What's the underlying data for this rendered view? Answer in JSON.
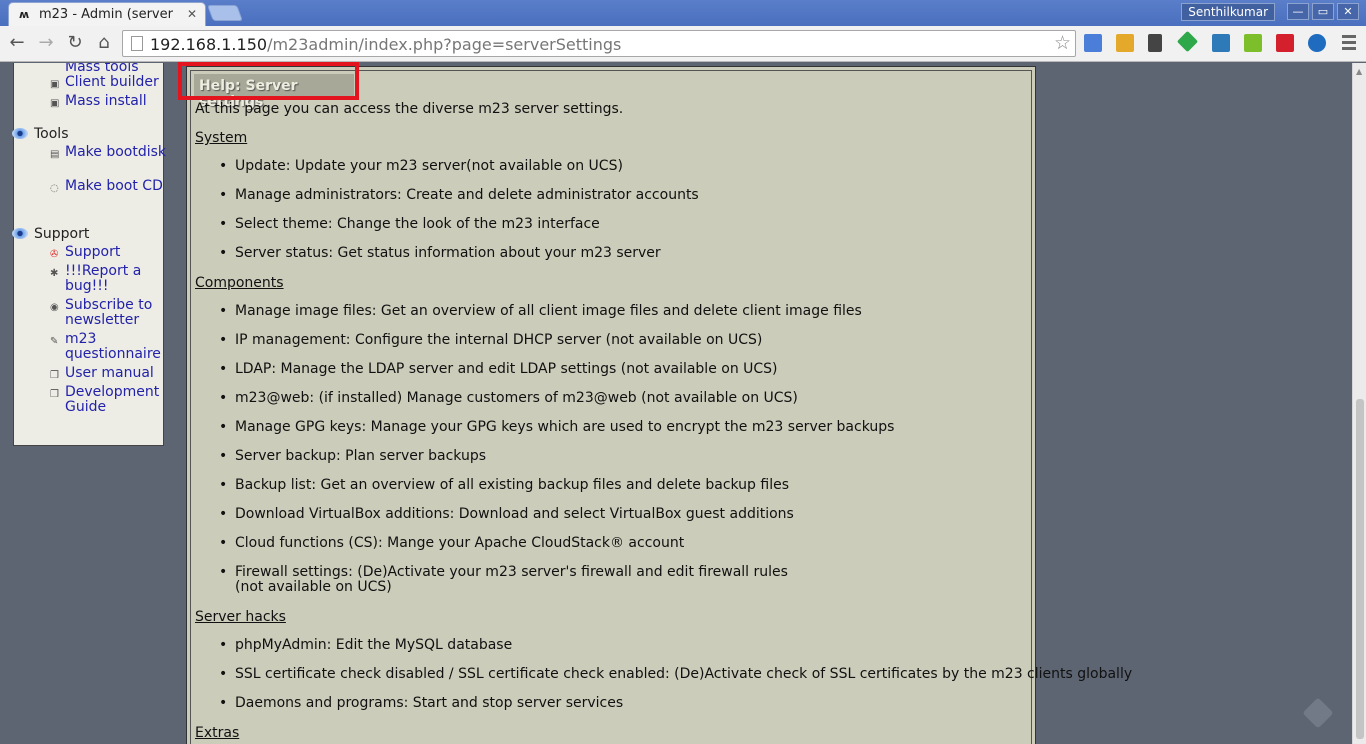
{
  "browser": {
    "tab_title": "m23 - Admin (server",
    "tab_favicon": "ʍ",
    "user_name": "Senthilkumar",
    "url_host": "192.168.1.150",
    "url_path": "/m23admin/index.php?page=serverSettings",
    "window_controls": [
      "—",
      "▭",
      "✕"
    ]
  },
  "sidebar": {
    "partial_top": "Mass tools",
    "items_top": [
      {
        "label": "Client builder",
        "icon": "client-builder-icon"
      },
      {
        "label": "Mass install",
        "icon": "mass-install-icon"
      }
    ],
    "tools_title": "Tools",
    "tools": [
      {
        "label": "Make bootdisk",
        "icon": "floppy-icon"
      },
      {
        "label": "Make boot CD",
        "icon": "cd-icon"
      }
    ],
    "support_title": "Support",
    "support": [
      {
        "label": "Support",
        "icon": "lifebuoy-icon"
      },
      {
        "label": "!!!Report a bug!!!",
        "icon": "bug-icon"
      },
      {
        "label": "Subscribe to newsletter",
        "icon": "newsletter-icon"
      },
      {
        "label": "m23 questionnaire",
        "icon": "questionnaire-icon"
      },
      {
        "label": "User manual",
        "icon": "manual-icon"
      },
      {
        "label": "Development Guide",
        "icon": "guide-icon"
      }
    ]
  },
  "help": {
    "header": "Help: Server settings",
    "intro": "At this page you can access the diverse m23 server settings.",
    "system_title": "System",
    "system": [
      "Update: Update your m23 server(not available on UCS)",
      "Manage administrators: Create and delete administrator accounts",
      "Select theme: Change the look of the m23 interface",
      "Server status: Get status information about your m23 server"
    ],
    "components_title": "Components",
    "components": [
      "Manage image files: Get an overview of all client image files and delete client image files",
      "IP management: Configure the internal DHCP server (not available on UCS)",
      "LDAP: Manage the LDAP server and edit LDAP settings (not available on UCS)",
      "m23@web: (if installed) Manage customers of m23@web (not available on UCS)",
      "Manage GPG keys: Manage your GPG keys which are used to encrypt the m23 server backups",
      "Server backup: Plan server backups",
      "Backup list: Get an overview of all existing backup files and delete backup files",
      "Download VirtualBox additions: Download and select VirtualBox guest additions",
      "Cloud functions (CS): Mange your Apache CloudStack® account"
    ],
    "firewall_line1": "Firewall settings: (De)Activate your m23 server's firewall and edit firewall rules",
    "firewall_line2": "(not available on UCS)",
    "hacks_title": "Server hacks",
    "hacks": [
      "phpMyAdmin: Edit the MySQL database",
      "SSL certificate check disabled / SSL certificate check enabled: (De)Activate check of SSL certificates by the m23 clients globally",
      "Daemons and programs: Start and stop server services"
    ],
    "extras_title": "Extras"
  },
  "colors": {
    "page_bg": "#5e6572",
    "panel_bg": "#ccccbb",
    "highlight": "#e3141e",
    "link": "#2222aa"
  }
}
